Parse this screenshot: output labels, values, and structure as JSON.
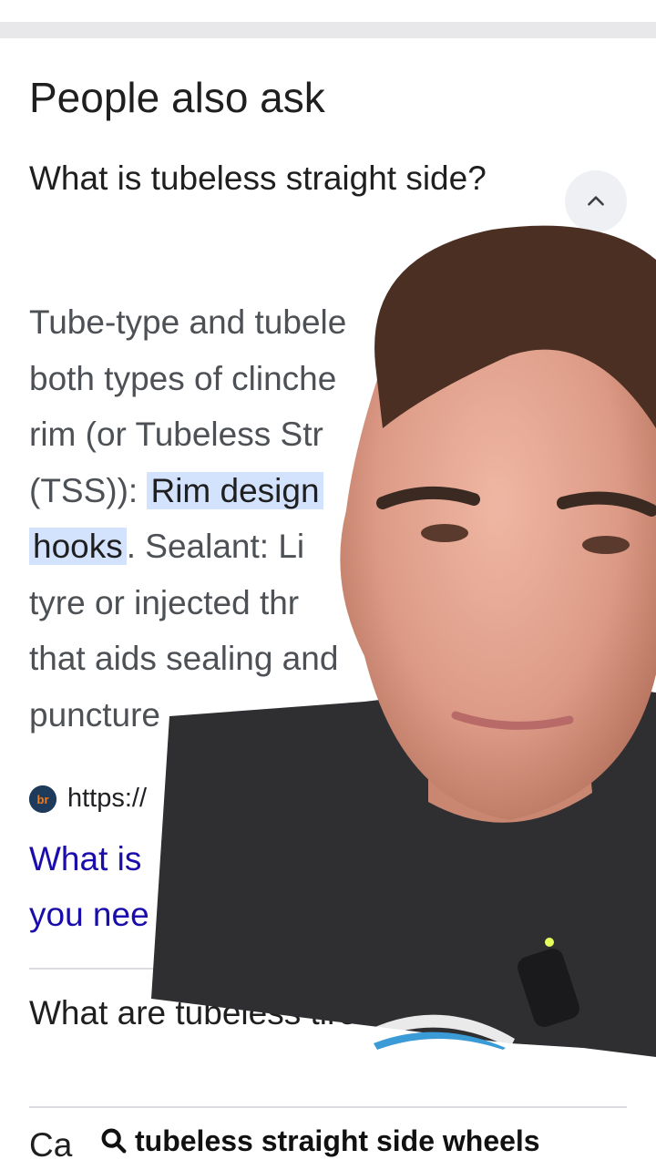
{
  "section": {
    "title": "People also ask"
  },
  "questions": [
    {
      "text": "What is tubeless straight side?"
    },
    {
      "text": "What are tubeless tires?"
    },
    {
      "text": "Ca"
    }
  ],
  "answer": {
    "line1": "Tube-type and tubele",
    "line2": "both types of clinche",
    "line3": "rim (or Tubeless Str",
    "line4_pre": "(TSS)): ",
    "line4_highlight": "Rim design",
    "line5_highlight": "hooks",
    "line5_post": ". Sealant: Li",
    "line6": "tyre or injected thr",
    "line7": "that aids sealing and",
    "line8": "puncture"
  },
  "source": {
    "favicon_text": "br",
    "url": "https://"
  },
  "result": {
    "line1": "What is",
    "line2": "you nee"
  },
  "search_chip": {
    "query": "tubeless straight side wheels"
  },
  "icons": {
    "collapse": "chevron-up-icon",
    "search": "search-icon"
  },
  "colors": {
    "link": "#1a0dab",
    "highlight": "#d3e3fd",
    "text": "#4d5156"
  }
}
